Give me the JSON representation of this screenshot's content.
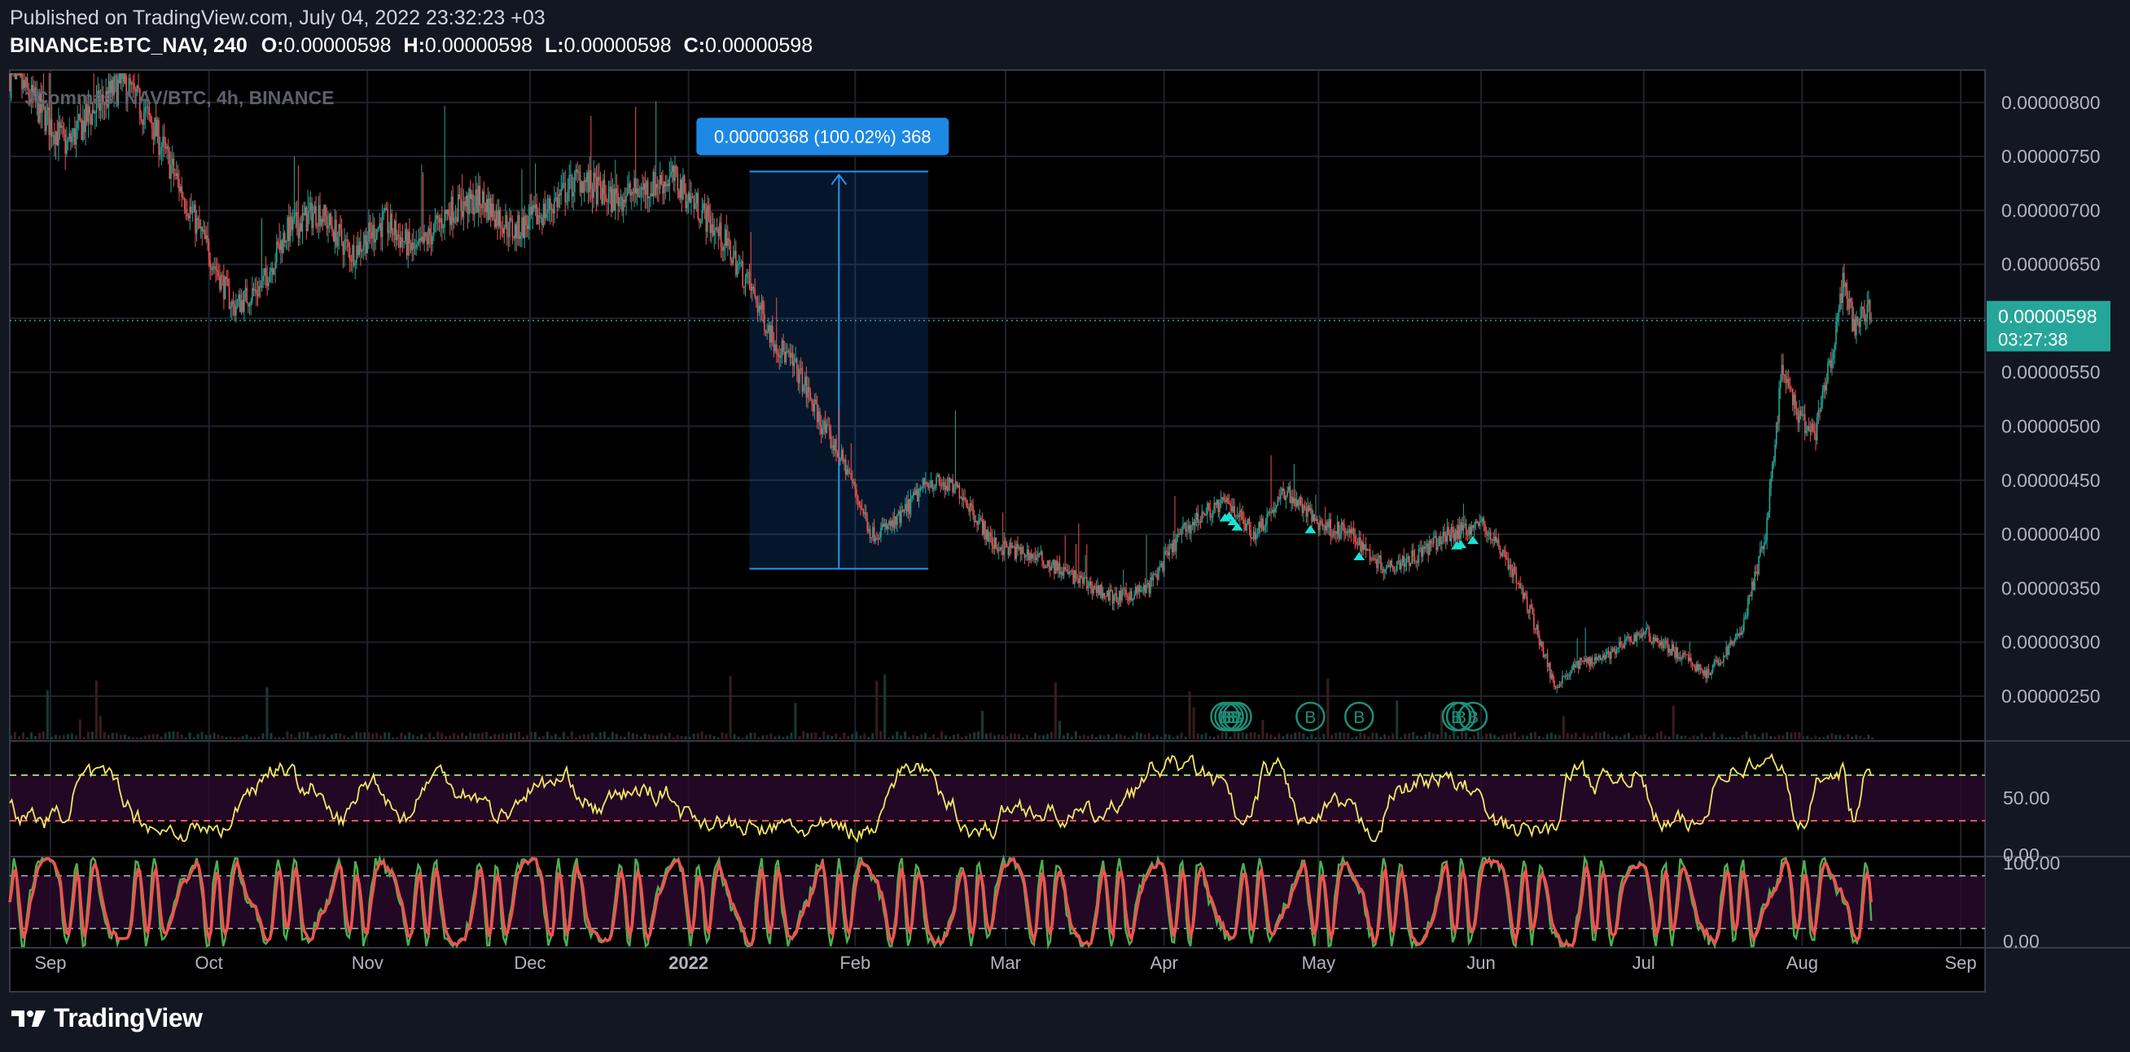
{
  "header": {
    "published": "Published on TradingView.com, July 04, 2022 23:32:23 +03",
    "symbol": "BINANCE:BTC_NAV, 240",
    "o_label": "O:",
    "o_value": "0.00000598",
    "h_label": "H:",
    "h_value": "0.00000598",
    "l_label": "L:",
    "l_value": "0.00000598",
    "c_label": "C:",
    "c_value": "0.00000598"
  },
  "watermark": "3Commas, NAV/BTC, 4h, BINANCE",
  "brand": "TradingView",
  "colors": {
    "background": "#000000",
    "frame": "#131722",
    "up": "#26a69a",
    "down": "#ef5350",
    "rsi": "#f5e663",
    "stoch_k": "#4caf50",
    "stoch_d": "#ef5350",
    "price_label": "#26a69a",
    "measure_box": "#1565c0"
  },
  "price_label": {
    "value": "0.00000598",
    "countdown": "03:27:38"
  },
  "measure_label": "0.00000368 (100.02%) 368",
  "chart_data": {
    "type": "candlestick",
    "x_ticks": [
      "Sep",
      "Oct",
      "Nov",
      "Dec",
      "2022",
      "Feb",
      "Mar",
      "Apr",
      "May",
      "Jun",
      "Jul",
      "Aug",
      "Sep"
    ],
    "y_ticks": [
      "0.00000800",
      "0.00000750",
      "0.00000700",
      "0.00000650",
      "0.00000600",
      "0.00000550",
      "0.00000500",
      "0.00000450",
      "0.00000400",
      "0.00000350",
      "0.00000300",
      "0.00000250"
    ],
    "ylim": [
      2.1e-06,
      8.3e-06
    ],
    "current_price": 5.98e-06,
    "price_path": [
      [
        0,
        8.3e-06
      ],
      [
        8,
        7.9e-06
      ],
      [
        14,
        7.6e-06
      ],
      [
        20,
        7.9e-06
      ],
      [
        28,
        8.2e-06
      ],
      [
        35,
        7.8e-06
      ],
      [
        42,
        7.2e-06
      ],
      [
        48,
        6.7e-06
      ],
      [
        55,
        6.1e-06
      ],
      [
        62,
        6.3e-06
      ],
      [
        68,
        6.8e-06
      ],
      [
        76,
        7e-06
      ],
      [
        84,
        6.6e-06
      ],
      [
        92,
        6.9e-06
      ],
      [
        100,
        6.6e-06
      ],
      [
        108,
        7e-06
      ],
      [
        116,
        7.1e-06
      ],
      [
        124,
        6.8e-06
      ],
      [
        132,
        7e-06
      ],
      [
        140,
        7.3e-06
      ],
      [
        148,
        7.1e-06
      ],
      [
        156,
        7.2e-06
      ],
      [
        163,
        7.3e-06
      ],
      [
        170,
        7e-06
      ],
      [
        176,
        6.7e-06
      ],
      [
        182,
        6.3e-06
      ],
      [
        188,
        5.8e-06
      ],
      [
        194,
        5.5e-06
      ],
      [
        200,
        5e-06
      ],
      [
        206,
        4.6e-06
      ],
      [
        212,
        4e-06
      ],
      [
        218,
        4.1e-06
      ],
      [
        226,
        4.5e-06
      ],
      [
        234,
        4.4e-06
      ],
      [
        242,
        3.9e-06
      ],
      [
        252,
        3.8e-06
      ],
      [
        262,
        3.6e-06
      ],
      [
        272,
        3.4e-06
      ],
      [
        280,
        3.5e-06
      ],
      [
        288,
        4e-06
      ],
      [
        294,
        4.2e-06
      ],
      [
        300,
        4.3e-06
      ],
      [
        306,
        4e-06
      ],
      [
        314,
        4.4e-06
      ],
      [
        322,
        4.1e-06
      ],
      [
        330,
        4e-06
      ],
      [
        338,
        3.7e-06
      ],
      [
        346,
        3.8e-06
      ],
      [
        354,
        4e-06
      ],
      [
        362,
        4.1e-06
      ],
      [
        368,
        3.8e-06
      ],
      [
        374,
        3.3e-06
      ],
      [
        380,
        2.6e-06
      ],
      [
        386,
        2.8e-06
      ],
      [
        394,
        2.9e-06
      ],
      [
        402,
        3.1e-06
      ],
      [
        410,
        2.9e-06
      ],
      [
        418,
        2.7e-06
      ],
      [
        426,
        3.1e-06
      ],
      [
        432,
        4e-06
      ],
      [
        436,
        5.5e-06
      ],
      [
        440,
        5.1e-06
      ],
      [
        444,
        4.9e-06
      ],
      [
        448,
        5.6e-06
      ],
      [
        451,
        6.3e-06
      ],
      [
        454,
        5.9e-06
      ],
      [
        458,
        6.2e-06
      ]
    ],
    "volume_note": "volume histogram",
    "measure": {
      "change": "0.00000368",
      "percent": "100.02%",
      "ticks": "368"
    },
    "signals": [
      {
        "day": 299,
        "type": "buy"
      },
      {
        "day": 300,
        "type": "buy"
      },
      {
        "day": 301,
        "type": "buy"
      },
      {
        "day": 302,
        "type": "buy"
      },
      {
        "day": 320,
        "type": "buy"
      },
      {
        "day": 332,
        "type": "buy"
      },
      {
        "day": 356,
        "type": "buy"
      },
      {
        "day": 357,
        "type": "buy"
      },
      {
        "day": 360,
        "type": "buy"
      }
    ],
    "signal_label": "B",
    "rsi": {
      "ticks": [
        "50.00",
        "0.00"
      ],
      "upper": 70,
      "lower": 30,
      "range": [
        0,
        100
      ]
    },
    "stoch": {
      "ticks": [
        "100.00",
        "0.00"
      ],
      "upper": 80,
      "lower": 20,
      "range": [
        0,
        100
      ]
    }
  }
}
